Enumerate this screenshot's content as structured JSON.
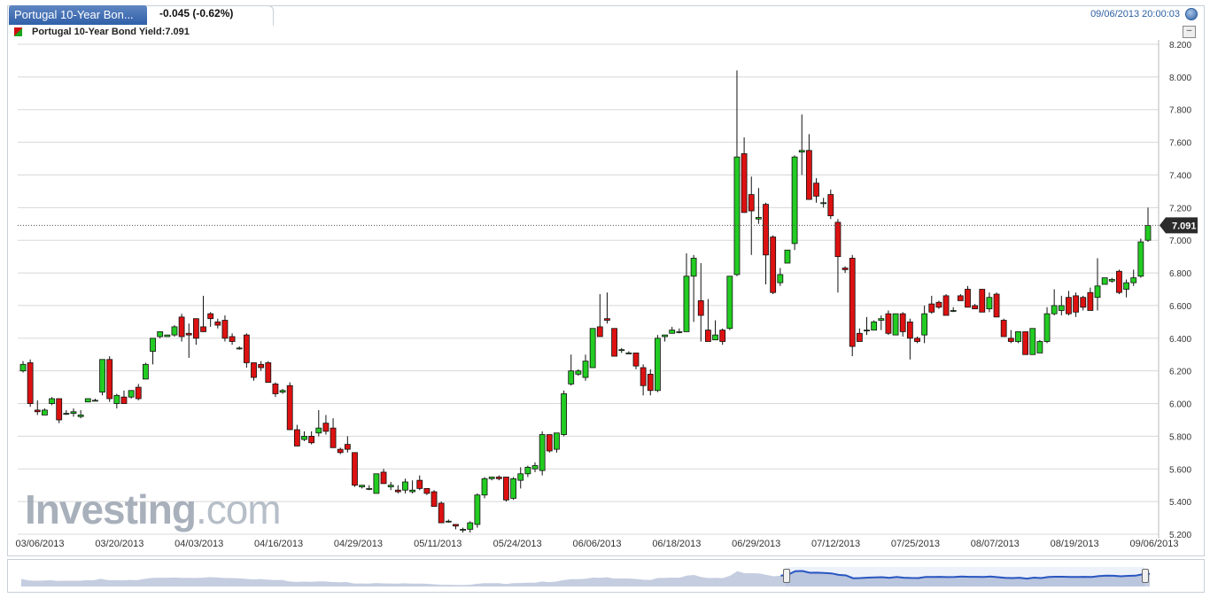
{
  "header": {
    "tab_title": "Portugal 10-Year Bon...",
    "change": "-0.045 (-0.62%)",
    "datetime": "09/06/2013 20:00:03"
  },
  "legend": {
    "label": "Portugal 10-Year Bond Yield:7.091"
  },
  "watermark": {
    "main": "Investing",
    "suffix": ".com"
  },
  "colors": {
    "up": "#22cc22",
    "down": "#dd1111",
    "grid": "#d8d8d8",
    "price_tag": "#2b2b2b",
    "navigator_line": "#1f4fbf",
    "navigator_fill": "#c5cde0"
  },
  "chart_data": {
    "type": "candlestick",
    "title": "Portugal 10-Year Bond Yield",
    "last_value": "7.091",
    "ylim": [
      5.2,
      8.2
    ],
    "y_ticks": [
      "5.200",
      "5.400",
      "5.600",
      "5.800",
      "6.000",
      "6.200",
      "6.400",
      "6.600",
      "6.800",
      "7.000",
      "7.200",
      "7.400",
      "7.600",
      "7.800",
      "8.000",
      "8.200"
    ],
    "x_tick_labels": [
      "03/06/2013",
      "03/20/2013",
      "04/03/2013",
      "04/16/2013",
      "04/29/2013",
      "05/11/2013",
      "05/24/2013",
      "06/06/2013",
      "06/18/2013",
      "06/29/2013",
      "07/12/2013",
      "07/25/2013",
      "08/07/2013",
      "08/19/2013",
      "09/06/2013"
    ],
    "grid": true,
    "candles": [
      [
        6.2,
        6.26,
        6.19,
        6.24
      ],
      [
        6.25,
        6.27,
        5.98,
        6.0
      ],
      [
        5.96,
        6.02,
        5.93,
        5.95
      ],
      [
        5.93,
        5.97,
        5.93,
        5.96
      ],
      [
        6.0,
        6.04,
        5.99,
        6.03
      ],
      [
        6.03,
        6.03,
        5.88,
        5.9
      ],
      [
        5.94,
        5.96,
        5.93,
        5.94
      ],
      [
        5.94,
        5.97,
        5.92,
        5.95
      ],
      [
        5.92,
        5.96,
        5.91,
        5.93
      ],
      [
        6.01,
        6.03,
        6.01,
        6.03
      ],
      [
        6.02,
        6.03,
        6.02,
        6.02
      ],
      [
        6.07,
        6.22,
        6.05,
        6.27
      ],
      [
        6.27,
        6.29,
        6.01,
        6.03
      ],
      [
        6.0,
        6.06,
        5.97,
        6.05
      ],
      [
        6.04,
        6.08,
        6.0,
        6.0
      ],
      [
        6.04,
        6.08,
        6.03,
        6.08
      ],
      [
        6.1,
        6.12,
        6.02,
        6.03
      ],
      [
        6.15,
        6.25,
        6.15,
        6.24
      ],
      [
        6.32,
        6.36,
        6.24,
        6.4
      ],
      [
        6.41,
        6.44,
        6.4,
        6.44
      ],
      [
        6.41,
        6.42,
        6.41,
        6.42
      ],
      [
        6.42,
        6.48,
        6.41,
        6.47
      ],
      [
        6.53,
        6.55,
        6.38,
        6.41
      ],
      [
        6.43,
        6.49,
        6.28,
        6.42
      ],
      [
        6.52,
        6.52,
        6.36,
        6.4
      ],
      [
        6.47,
        6.66,
        6.44,
        6.44
      ],
      [
        6.55,
        6.56,
        6.47,
        6.52
      ],
      [
        6.5,
        6.52,
        6.46,
        6.48
      ],
      [
        6.51,
        6.54,
        6.38,
        6.4
      ],
      [
        6.41,
        6.43,
        6.36,
        6.38
      ],
      [
        6.34,
        6.35,
        6.33,
        6.34
      ],
      [
        6.42,
        6.43,
        6.22,
        6.25
      ],
      [
        6.25,
        6.25,
        6.14,
        6.16
      ],
      [
        6.24,
        6.26,
        6.2,
        6.22
      ],
      [
        6.25,
        6.26,
        6.14,
        6.13
      ],
      [
        6.12,
        6.13,
        6.04,
        6.06
      ],
      [
        6.07,
        6.09,
        6.06,
        6.08
      ],
      [
        6.11,
        6.13,
        5.84,
        5.84
      ],
      [
        5.84,
        5.87,
        5.74,
        5.74
      ],
      [
        5.78,
        5.83,
        5.77,
        5.8
      ],
      [
        5.8,
        5.83,
        5.75,
        5.76
      ],
      [
        5.82,
        5.96,
        5.8,
        5.85
      ],
      [
        5.88,
        5.93,
        5.81,
        5.83
      ],
      [
        5.85,
        5.91,
        5.73,
        5.73
      ],
      [
        5.72,
        5.73,
        5.69,
        5.7
      ],
      [
        5.75,
        5.8,
        5.7,
        5.72
      ],
      [
        5.7,
        5.7,
        5.49,
        5.5
      ],
      [
        5.49,
        5.5,
        5.48,
        5.5
      ],
      [
        5.48,
        5.5,
        5.47,
        5.48
      ],
      [
        5.45,
        5.57,
        5.45,
        5.57
      ],
      [
        5.58,
        5.6,
        5.51,
        5.51
      ],
      [
        5.49,
        5.52,
        5.47,
        5.5
      ],
      [
        5.47,
        5.5,
        5.45,
        5.46
      ],
      [
        5.47,
        5.54,
        5.45,
        5.52
      ],
      [
        5.46,
        5.53,
        5.45,
        5.47
      ],
      [
        5.53,
        5.56,
        5.47,
        5.48
      ],
      [
        5.48,
        5.48,
        5.44,
        5.45
      ],
      [
        5.46,
        5.47,
        5.4,
        5.37
      ],
      [
        5.39,
        5.4,
        5.28,
        5.27
      ],
      [
        5.28,
        5.29,
        5.27,
        5.28
      ],
      [
        5.26,
        5.26,
        5.23,
        5.25
      ],
      [
        5.23,
        5.24,
        5.21,
        5.23
      ],
      [
        5.23,
        5.28,
        5.21,
        5.27
      ],
      [
        5.26,
        5.45,
        5.24,
        5.44
      ],
      [
        5.44,
        5.55,
        5.42,
        5.54
      ],
      [
        5.54,
        5.55,
        5.53,
        5.55
      ],
      [
        5.55,
        5.56,
        5.53,
        5.54
      ],
      [
        5.55,
        5.55,
        5.4,
        5.41
      ],
      [
        5.42,
        5.55,
        5.41,
        5.54
      ],
      [
        5.53,
        5.61,
        5.48,
        5.57
      ],
      [
        5.57,
        5.62,
        5.55,
        5.61
      ],
      [
        5.6,
        5.64,
        5.58,
        5.62
      ],
      [
        5.59,
        5.83,
        5.56,
        5.81
      ],
      [
        5.81,
        5.81,
        5.7,
        5.71
      ],
      [
        5.72,
        5.82,
        5.7,
        5.82
      ],
      [
        5.81,
        6.08,
        5.8,
        6.06
      ],
      [
        6.12,
        6.3,
        6.11,
        6.2
      ],
      [
        6.18,
        6.21,
        6.17,
        6.2
      ],
      [
        6.16,
        6.3,
        6.14,
        6.26
      ],
      [
        6.22,
        6.46,
        6.22,
        6.46
      ],
      [
        6.47,
        6.67,
        6.43,
        6.41
      ],
      [
        6.52,
        6.68,
        6.49,
        6.51
      ],
      [
        6.46,
        6.46,
        6.31,
        6.29
      ],
      [
        6.33,
        6.34,
        6.31,
        6.33
      ],
      [
        6.31,
        6.32,
        6.31,
        6.31
      ],
      [
        6.31,
        6.31,
        6.21,
        6.23
      ],
      [
        6.22,
        6.24,
        6.05,
        6.11
      ],
      [
        6.18,
        6.21,
        6.05,
        6.08
      ],
      [
        6.08,
        6.42,
        6.07,
        6.4
      ],
      [
        6.41,
        6.42,
        6.38,
        6.42
      ],
      [
        6.43,
        6.47,
        6.43,
        6.45
      ],
      [
        6.44,
        6.46,
        6.43,
        6.44
      ],
      [
        6.44,
        6.92,
        6.44,
        6.78
      ],
      [
        6.78,
        6.91,
        6.5,
        6.89
      ],
      [
        6.63,
        6.86,
        6.38,
        6.54
      ],
      [
        6.45,
        6.64,
        6.38,
        6.38
      ],
      [
        6.39,
        6.51,
        6.39,
        6.42
      ],
      [
        6.45,
        6.46,
        6.36,
        6.38
      ],
      [
        6.46,
        6.78,
        6.45,
        6.78
      ],
      [
        6.79,
        8.04,
        6.78,
        7.51
      ],
      [
        7.53,
        7.63,
        7.22,
        7.17
      ],
      [
        7.28,
        7.39,
        6.91,
        7.18
      ],
      [
        7.13,
        7.32,
        7.1,
        7.14
      ],
      [
        7.22,
        7.23,
        6.73,
        6.91
      ],
      [
        7.02,
        7.03,
        6.67,
        6.68
      ],
      [
        6.74,
        6.83,
        6.72,
        6.79
      ],
      [
        6.86,
        6.94,
        6.87,
        6.94
      ],
      [
        6.98,
        7.52,
        6.94,
        7.51
      ],
      [
        7.54,
        7.77,
        7.4,
        7.55
      ],
      [
        7.55,
        7.65,
        7.25,
        7.25
      ],
      [
        7.35,
        7.38,
        7.23,
        7.27
      ],
      [
        7.23,
        7.26,
        7.2,
        7.23
      ],
      [
        7.28,
        7.31,
        7.13,
        7.15
      ],
      [
        7.11,
        7.13,
        6.68,
        6.9
      ],
      [
        6.83,
        6.84,
        6.8,
        6.82
      ],
      [
        6.89,
        6.91,
        6.29,
        6.35
      ],
      [
        6.43,
        6.46,
        6.38,
        6.38
      ],
      [
        6.45,
        6.53,
        6.42,
        6.45
      ],
      [
        6.45,
        6.51,
        6.45,
        6.5
      ],
      [
        6.51,
        6.54,
        6.45,
        6.52
      ],
      [
        6.55,
        6.57,
        6.42,
        6.43
      ],
      [
        6.42,
        6.55,
        6.42,
        6.55
      ],
      [
        6.55,
        6.56,
        6.41,
        6.44
      ],
      [
        6.5,
        6.52,
        6.27,
        6.4
      ],
      [
        6.4,
        6.41,
        6.37,
        6.38
      ],
      [
        6.42,
        6.6,
        6.37,
        6.55
      ],
      [
        6.61,
        6.66,
        6.55,
        6.56
      ],
      [
        6.62,
        6.63,
        6.58,
        6.59
      ],
      [
        6.66,
        6.67,
        6.54,
        6.54
      ],
      [
        6.57,
        6.59,
        6.56,
        6.57
      ],
      [
        6.66,
        6.67,
        6.64,
        6.63
      ],
      [
        6.7,
        6.72,
        6.61,
        6.59
      ],
      [
        6.6,
        6.61,
        6.59,
        6.58
      ],
      [
        6.7,
        6.7,
        6.56,
        6.56
      ],
      [
        6.58,
        6.68,
        6.56,
        6.65
      ],
      [
        6.67,
        6.68,
        6.58,
        6.53
      ],
      [
        6.51,
        6.52,
        6.41,
        6.41
      ],
      [
        6.4,
        6.45,
        6.37,
        6.38
      ],
      [
        6.38,
        6.43,
        6.37,
        6.44
      ],
      [
        6.44,
        6.44,
        6.3,
        6.3
      ],
      [
        6.3,
        6.46,
        6.3,
        6.46
      ],
      [
        6.31,
        6.39,
        6.31,
        6.38
      ],
      [
        6.38,
        6.59,
        6.37,
        6.55
      ],
      [
        6.55,
        6.7,
        6.54,
        6.6
      ],
      [
        6.57,
        6.66,
        6.54,
        6.6
      ],
      [
        6.65,
        6.69,
        6.54,
        6.55
      ],
      [
        6.66,
        6.68,
        6.53,
        6.56
      ],
      [
        6.65,
        6.66,
        6.57,
        6.59
      ],
      [
        6.68,
        6.71,
        6.58,
        6.57
      ],
      [
        6.65,
        6.89,
        6.57,
        6.72
      ],
      [
        6.73,
        6.77,
        6.74,
        6.77
      ],
      [
        6.75,
        6.77,
        6.74,
        6.76
      ],
      [
        6.81,
        6.82,
        6.67,
        6.68
      ],
      [
        6.7,
        6.76,
        6.65,
        6.74
      ],
      [
        6.74,
        6.82,
        6.72,
        6.77
      ],
      [
        6.78,
        7.01,
        6.77,
        6.99
      ],
      [
        7.0,
        7.2,
        6.99,
        7.09
      ]
    ]
  }
}
